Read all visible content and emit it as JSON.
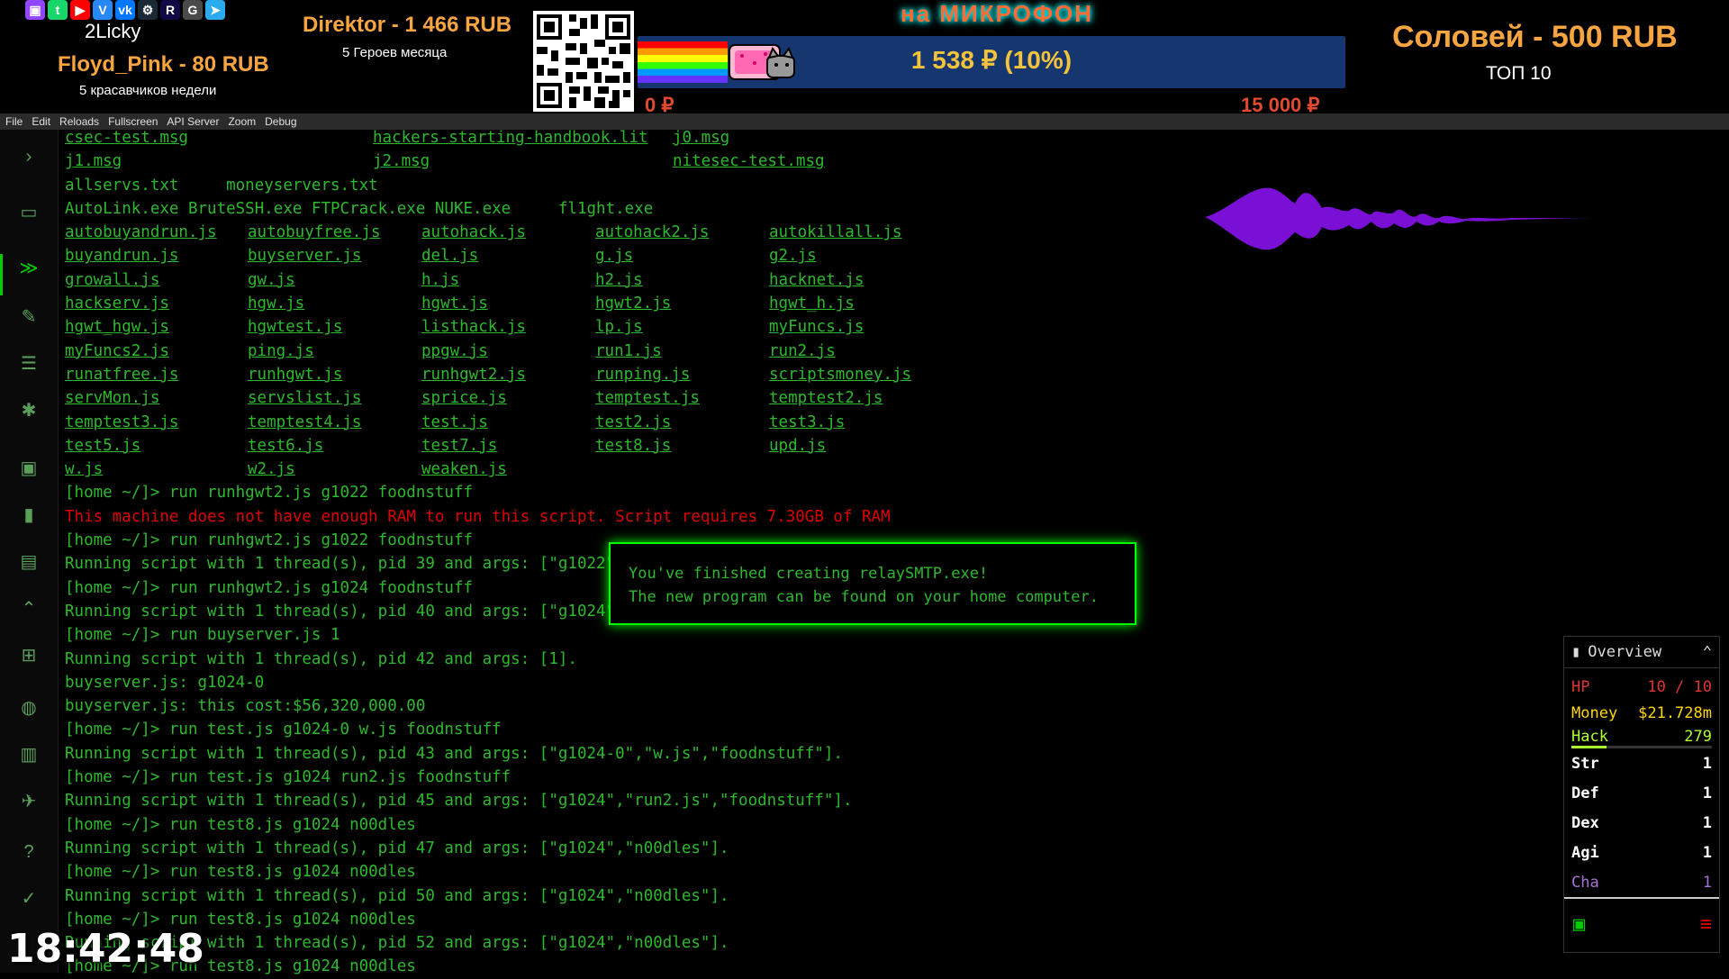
{
  "overlay": {
    "social_icons": [
      "twitch-icon",
      "trovo-icon",
      "youtube-icon",
      "vk-video-icon",
      "vk-icon",
      "steam-icon",
      "rutube-icon",
      "goodgame-icon",
      "telegram-icon"
    ],
    "top_donor_left_name": "2Licky",
    "left_donor": "Floyd_Pink - 80 RUB",
    "left_caption": "5 красавчиков недели",
    "center_donor": "Direktor - 1 466 RUB",
    "center_caption": "5 Героев месяца",
    "mic_title": "на МИКРОФОН",
    "goal_amount": "1 538 ₽ (10%)",
    "goal_min": "0 ₽",
    "goal_max": "15 000 ₽",
    "goal_progress": 0.1,
    "right_donor": "Соловей - 500 RUB",
    "right_caption": "ТОП 10",
    "clock": "18:42:48"
  },
  "menubar": {
    "items": [
      "File",
      "Edit",
      "Reloads",
      "Fullscreen",
      "API Server",
      "Zoom",
      "Debug"
    ]
  },
  "sidebar": {
    "icons": [
      "chevron-right-icon",
      "terminal-monitor-icon",
      "script-icon",
      "editor-pencil-icon",
      "active-scripts-list-icon",
      "bug-icon",
      "stats-person-icon",
      "stats-bar-icon",
      "faction-icon",
      "augmentations-icon",
      "hacknet-icon",
      "world-globe-icon",
      "city-icon",
      "travel-plane-icon",
      "help-icon",
      "milestones-check-icon"
    ]
  },
  "terminal": {
    "top_links": [
      [
        "csec-test.msg",
        "hackers-starting-handbook.lit",
        "j0.msg"
      ],
      [
        "j1.msg",
        "j2.msg",
        "nitesec-test.msg"
      ]
    ],
    "plain_files": "allservs.txt     moneyservers.txt",
    "programs": "AutoLink.exe BruteSSH.exe FTPCrack.exe NUKE.exe     fl1ght.exe",
    "scripts": [
      [
        "autobuyandrun.js",
        "autobuyfree.js",
        "autohack.js",
        "autohack2.js",
        "autokillall.js"
      ],
      [
        "buyandrun.js",
        "buyserver.js",
        "del.js",
        "g.js",
        "g2.js"
      ],
      [
        "growall.js",
        "gw.js",
        "h.js",
        "h2.js",
        "hacknet.js"
      ],
      [
        "hackserv.js",
        "hgw.js",
        "hgwt.js",
        "hgwt2.js",
        "hgwt_h.js"
      ],
      [
        "hgwt_hgw.js",
        "hgwtest.js",
        "listhack.js",
        "lp.js",
        "myFuncs.js"
      ],
      [
        "myFuncs2.js",
        "ping.js",
        "ppgw.js",
        "run1.js",
        "run2.js"
      ],
      [
        "runatfree.js",
        "runhgwt.js",
        "runhgwt2.js",
        "runping.js",
        "scriptsmoney.js"
      ],
      [
        "servMon.js",
        "servslist.js",
        "sprice.js",
        "temptest.js",
        "temptest2.js"
      ],
      [
        "temptest3.js",
        "temptest4.js",
        "test.js",
        "test2.js",
        "test3.js"
      ],
      [
        "test5.js",
        "test6.js",
        "test7.js",
        "test8.js",
        "upd.js"
      ],
      [
        "w.js",
        "w2.js",
        "weaken.js",
        "",
        ""
      ]
    ],
    "lines": [
      {
        "text": "[home ~/]> run runhgwt2.js g1022 foodnstuff",
        "color": "green"
      },
      {
        "text": "This machine does not have enough RAM to run this script. Script requires 7.30GB of RAM",
        "color": "red"
      },
      {
        "text": "[home ~/]> run runhgwt2.js g1022 foodnstuff",
        "color": "green"
      },
      {
        "text": "Running script with 1 thread(s), pid 39 and args: [\"g1022\",\"foodnstuff\"].",
        "color": "green"
      },
      {
        "text": "[home ~/]> run runhgwt2.js g1024 foodnstuff",
        "color": "green"
      },
      {
        "text": "Running script with 1 thread(s), pid 40 and args: [\"g1024\",\"foodnstuff\"].",
        "color": "green"
      },
      {
        "text": "[home ~/]> run buyserver.js 1",
        "color": "green"
      },
      {
        "text": "Running script with 1 thread(s), pid 42 and args: [1].",
        "color": "green"
      },
      {
        "text": "buyserver.js: g1024-0",
        "color": "green"
      },
      {
        "text": "buyserver.js: this cost:$56,320,000.00",
        "color": "green"
      },
      {
        "text": "[home ~/]> run test.js g1024-0 w.js foodnstuff",
        "color": "green"
      },
      {
        "text": "Running script with 1 thread(s), pid 43 and args: [\"g1024-0\",\"w.js\",\"foodnstuff\"].",
        "color": "green"
      },
      {
        "text": "[home ~/]> run test.js g1024 run2.js foodnstuff",
        "color": "green"
      },
      {
        "text": "Running script with 1 thread(s), pid 45 and args: [\"g1024\",\"run2.js\",\"foodnstuff\"].",
        "color": "green"
      },
      {
        "text": "[home ~/]> run test8.js g1024 n00dles",
        "color": "green"
      },
      {
        "text": "Running script with 1 thread(s), pid 47 and args: [\"g1024\",\"n00dles\"].",
        "color": "green"
      },
      {
        "text": "[home ~/]> run test8.js g1024 n00dles",
        "color": "green"
      },
      {
        "text": "Running script with 1 thread(s), pid 50 and args: [\"g1024\",\"n00dles\"].",
        "color": "green"
      },
      {
        "text": "[home ~/]> run test8.js g1024 n00dles",
        "color": "green"
      },
      {
        "text": "Running script with 1 thread(s), pid 52 and args: [\"g1024\",\"n00dles\"].",
        "color": "green"
      },
      {
        "text": "[home ~/]> run test8.js g1024 n00dles",
        "color": "green"
      }
    ]
  },
  "toast": {
    "line1": "You've finished creating relaySMTP.exe!",
    "line2": "The new program can be found on your home computer."
  },
  "overview": {
    "title": "Overview",
    "hp_label": "HP",
    "hp_value": "10 / 10",
    "money_label": "Money",
    "money_value": "$21.728m",
    "hack_label": "Hack",
    "hack_value": "279",
    "str_label": "Str",
    "str_value": "1",
    "def_label": "Def",
    "def_value": "1",
    "dex_label": "Dex",
    "dex_value": "1",
    "agi_label": "Agi",
    "agi_value": "1",
    "cha_label": "Cha",
    "cha_value": "1",
    "colors": {
      "hp": "#dd3434",
      "money": "#ffd700",
      "hack": "#adff2f",
      "cha": "#a671d1"
    }
  }
}
